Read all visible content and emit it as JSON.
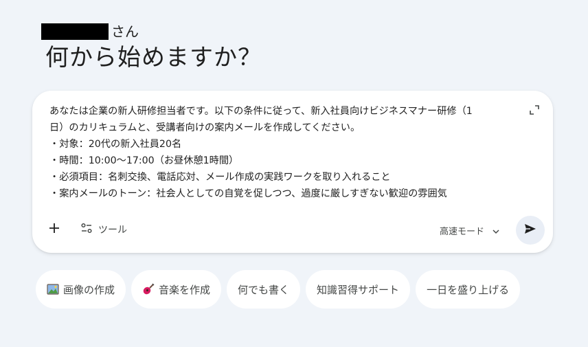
{
  "greeting": {
    "name_suffix": "さん",
    "headline": "何から始めますか？"
  },
  "composer": {
    "prompt_lines": [
      "あなたは企業の新人研修担当者です。以下の条件に従って、新入社員向けビジネスマナー研修（1",
      "日）のカリキュラムと、受講者向けの案内メールを作成してください。",
      "・対象：20代の新入社員20名",
      "・時間：10:00〜17:00（お昼休憩1時間）",
      "・必須項目：名刺交換、電話応対、メール作成の実践ワークを取り入れること",
      "・案内メールのトーン：社会人としての自覚を促しつつ、過度に厳しすぎない歓迎の雰囲気"
    ],
    "tools_label": "ツール",
    "mode_label": "高速モード"
  },
  "chips": [
    {
      "label": "画像の作成",
      "icon": "picture-emoji"
    },
    {
      "label": "音楽を作成",
      "icon": "guitar-emoji"
    },
    {
      "label": "何でも書く"
    },
    {
      "label": "知識習得サポート"
    },
    {
      "label": "一日を盛り上げる"
    }
  ],
  "colors": {
    "background": "#f0f4f9",
    "surface": "#ffffff",
    "send_button_bg": "#e9eef6",
    "text_primary": "#1f1f1f",
    "text_secondary": "#444746"
  }
}
